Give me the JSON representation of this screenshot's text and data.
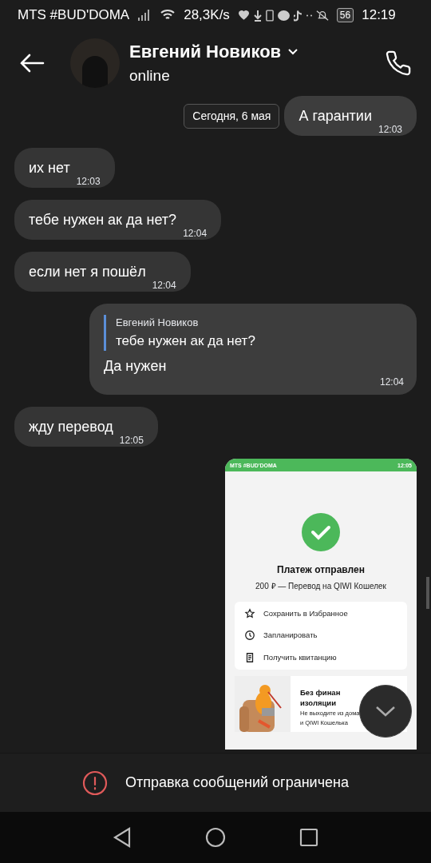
{
  "status_bar": {
    "carrier": "MTS #BUD'DOMA",
    "speed": "28,3K/s",
    "battery": "56",
    "time": "12:19"
  },
  "header": {
    "name": "Евгений Новиков",
    "status": "online"
  },
  "messages": [
    {
      "kind": "text",
      "outgoing": true,
      "date_chip": "Сегодня, 6 мая",
      "text": "А гарантии",
      "time": "12:03"
    },
    {
      "kind": "text",
      "outgoing": false,
      "text": "их нет",
      "time": "12:03"
    },
    {
      "kind": "text",
      "outgoing": false,
      "text": "тебе нужен ак да нет?",
      "time": "12:04"
    },
    {
      "kind": "text",
      "outgoing": false,
      "text": "если нет я пошёл",
      "time": "12:04"
    },
    {
      "kind": "reply",
      "outgoing": true,
      "quote_author": "Евгений Новиков",
      "quote_text": "тебе нужен ак да нет?",
      "text": "Да нужен",
      "time": "12:04"
    },
    {
      "kind": "text",
      "outgoing": false,
      "text": "жду перевод",
      "time": "12:05"
    },
    {
      "kind": "screenshot",
      "outgoing": true,
      "screenshot": {
        "carrier": "MTS #BUD'DOMA",
        "time": "12:05",
        "title": "Платеж отправлен",
        "subtitle": "200 ₽ — Перевод на QIWI Кошелек",
        "actions": [
          {
            "kind": "star",
            "label": "Сохранить в Избранное"
          },
          {
            "kind": "clock",
            "label": "Запланировать"
          },
          {
            "kind": "receipt",
            "label": "Получить квитанцию"
          }
        ],
        "promo": {
          "title": [
            "Без финан",
            "изоляции"
          ],
          "text": [
            "Не выходите из дома",
            "и QIWI Кошелька"
          ]
        }
      }
    }
  ],
  "notice": "Отправка сообщений ограничена"
}
